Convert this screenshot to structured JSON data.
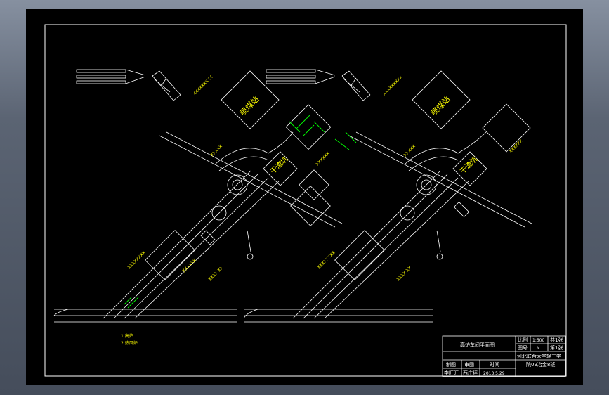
{
  "drawing": {
    "left_plan": {
      "label_a": "喷煤站",
      "label_b": "干渣坑"
    },
    "right_plan": {
      "label_a": "喷煤站",
      "label_b": "干渣坑"
    },
    "legend": [
      "1.高炉",
      "2.热风炉"
    ]
  },
  "title_block": {
    "title": "高炉车间平面图",
    "scale_label": "比例",
    "scale_value": "1:500",
    "drawing_no_label": "图号",
    "drawing_no_value": "N",
    "sheet_label": "第1张",
    "sheets_total": "共1张",
    "drawn_label": "制图",
    "checked_label": "审图",
    "date_label": "时间",
    "designer": "李旺旺",
    "checker": "西庄坪",
    "date": "2013.5.29",
    "school_line1": "河北联合大学轻工学",
    "school_line2": "院09冶金8班"
  },
  "colors": {
    "cad_background": "#000000",
    "line_white": "#ffffff",
    "text_yellow": "#ffff00",
    "line_green": "#00ff00",
    "viewport_frame": "#5b6473"
  }
}
